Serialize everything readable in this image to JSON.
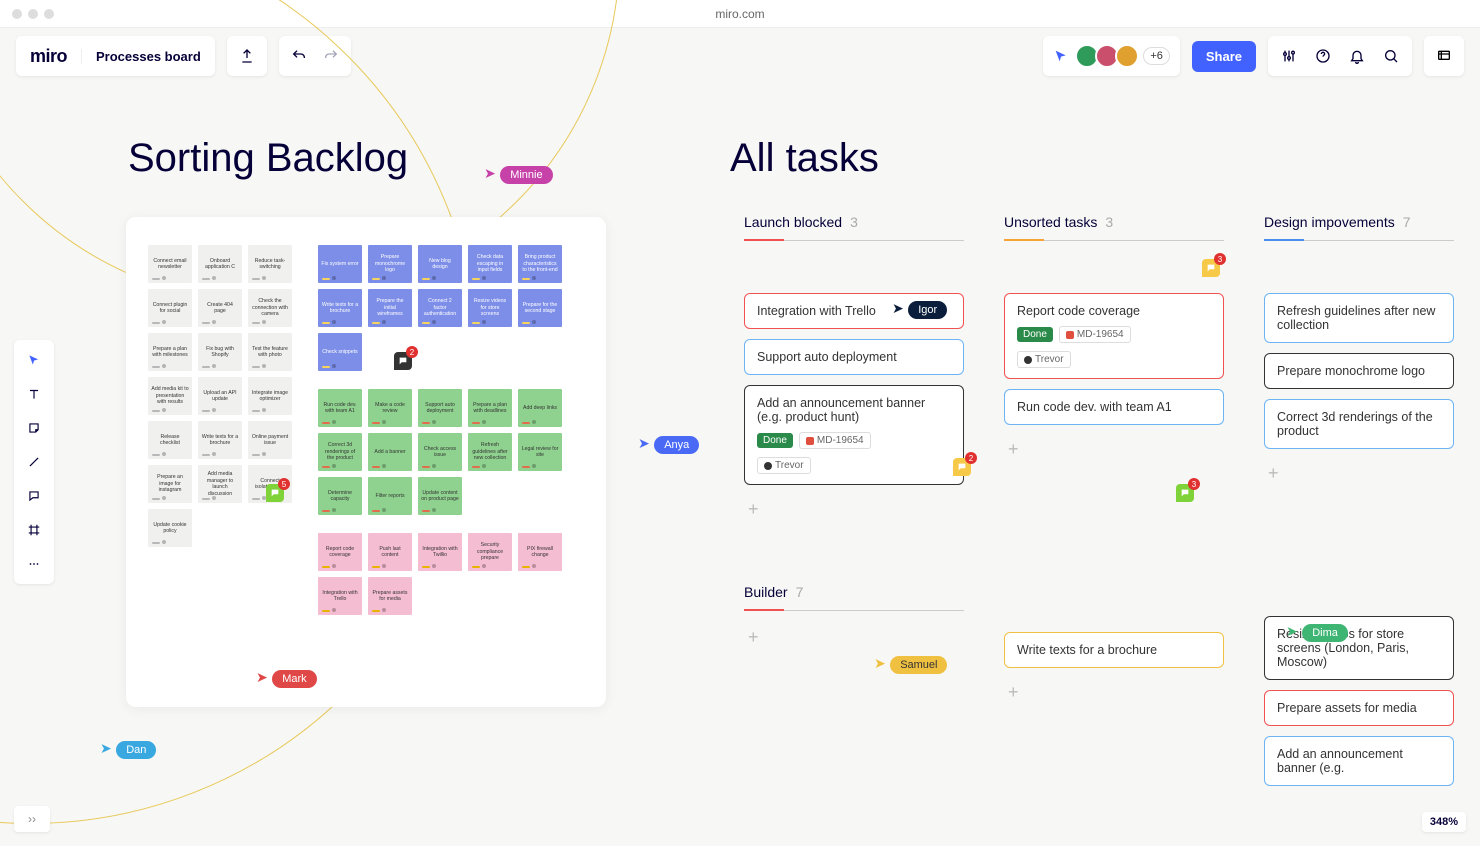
{
  "browser": {
    "url": "miro.com"
  },
  "header": {
    "logo": "miro",
    "board_name": "Processes board",
    "more_count": "+6",
    "share": "Share"
  },
  "headings": {
    "sorting": "Sorting Backlog",
    "all": "All tasks"
  },
  "stickies": {
    "gray": [
      [
        "Connect email newsletter",
        "Onboard application C",
        "Reduce task-switching"
      ],
      [
        "Connect plugin for social",
        "Create 404 page",
        "Check the connection with camera"
      ],
      [
        "Prepare a plan with milestones",
        "Fix bug with Shopify",
        "Test the feature with photo"
      ],
      [
        "Add media kit to presentation with results",
        "Upload an API update",
        "Integrate image optimizer"
      ],
      [
        "Release checklist",
        "Write texts for a brochure",
        "Online payment issue"
      ],
      [
        "Prepare an image for instagram",
        "Add media manager to launch discussion",
        "Connect isolated VPN"
      ],
      [
        "Update cookie policy"
      ]
    ],
    "blue": [
      [
        "Fix system error",
        "Prepare monochrome logo",
        "New blog design",
        "Check data escaping in input fields",
        "Bring product characteristics to the front-end"
      ],
      [
        "Write texts for a brochure",
        "Prepare the initial wireframes",
        "Connect 2 factor authentication",
        "Resize videos for store screens",
        "Prepare for the second stage"
      ],
      [
        "Check snippets"
      ]
    ],
    "green": [
      [
        "Run code dev. with team A1",
        "Make a code review",
        "Support auto deployment",
        "Prepare a plan with deadlines",
        "Add deep links"
      ],
      [
        "Correct 3d renderings of the product",
        "Add a banner",
        "Check access issue",
        "Refresh guidelines after new collection",
        "Legal review for site"
      ],
      [
        "Determine capacity",
        "Filter reports",
        "Update content on product page"
      ]
    ],
    "pink": [
      [
        "Report code coverage",
        "Push last content",
        "Integration with Twillio",
        "Security compliance prepare",
        "PIX firewall change"
      ],
      [
        "Integration with Trello",
        "Prepare assets for media"
      ]
    ]
  },
  "cursors": {
    "minnie": "Minnie",
    "mark": "Mark",
    "dan": "Dan",
    "anya": "Anya",
    "samuel": "Samuel",
    "igor": "Igor",
    "dima": "Dima"
  },
  "kanban": {
    "launch": {
      "title": "Launch blocked",
      "count": "3",
      "cards": [
        {
          "text": "Integration with Trello"
        },
        {
          "text": "Support auto deployment"
        },
        {
          "text": "Add an announcement banner (e.g. product hunt)",
          "done": "Done",
          "issue": "MD-19654",
          "person": "Trevor"
        }
      ]
    },
    "builder": {
      "title": "Builder",
      "count": "7"
    },
    "unsorted": {
      "title": "Unsorted tasks",
      "count": "3",
      "cards": [
        {
          "text": "Report code coverage",
          "done": "Done",
          "issue": "MD-19654",
          "person": "Trevor"
        },
        {
          "text": "Run code dev. with team A1"
        },
        {
          "text": "Write texts for a brochure"
        }
      ]
    },
    "design": {
      "title": "Design impovements",
      "count": "7",
      "cards": [
        {
          "text": "Refresh guidelines after new collection"
        },
        {
          "text": "Prepare monochrome logo"
        },
        {
          "text": "Correct 3d renderings of the product"
        },
        {
          "text": "Resize videos for store screens (London, Paris, Moscow)"
        },
        {
          "text": "Prepare assets for media"
        },
        {
          "text": "Add an announcement banner (e.g."
        }
      ]
    }
  },
  "zoom": "348%",
  "comments": {
    "b1": "2",
    "b2": "2",
    "b3": "3",
    "b4": "5",
    "b5": "3"
  }
}
